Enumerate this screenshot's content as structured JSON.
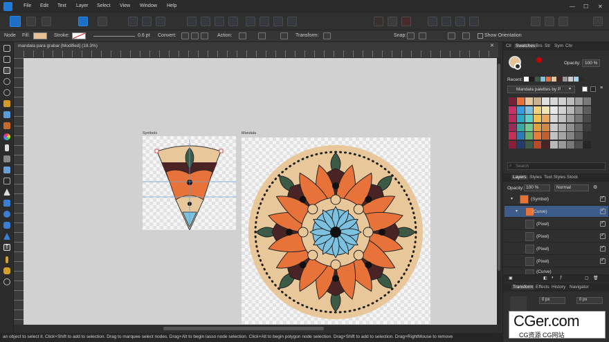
{
  "menu": {
    "items": [
      "File",
      "Edit",
      "Text",
      "Layer",
      "Select",
      "View",
      "Window",
      "Help"
    ]
  },
  "context": {
    "mode": "Node",
    "fill_label": "Fill:",
    "fill_color": "#e6c194",
    "stroke_label": "Stroke:",
    "stroke_width": "0.6 pt",
    "convert_label": "Convert:",
    "action_label": "Action:",
    "transform_label": "Transform:",
    "snap_label": "Snap:",
    "show_orientation": "Show Orientation"
  },
  "document": {
    "title": "mandala para grabar [Modified] (18.3%)"
  },
  "artboards": {
    "symbols": "Symbols",
    "mandala": "Mandala"
  },
  "panel": {
    "swatch_tabs": [
      "Clr",
      "Swatches",
      "Brs",
      "Str",
      "Sym",
      "Chr"
    ],
    "opacity_label": "Opacity:",
    "opacity_value": "100 %",
    "recent_label": "Recent:",
    "palette_name": "Mandala palettes by P",
    "search_placeholder": "Search",
    "layer_tabs": [
      "Layers",
      "Styles",
      "Text Styles",
      "Stock"
    ],
    "layer_opacity_label": "Opacity:",
    "layer_opacity_value": "100 %",
    "blend_mode": "Normal",
    "layers": [
      "(Symbol)",
      "(Curve)",
      "(Pixel)",
      "(Pixel)",
      "(Pixel)",
      "(Pixel)",
      "(Curve)"
    ],
    "transform_tabs": [
      "Transform",
      "Effects",
      "History",
      "Navigator"
    ],
    "transform_value": "0 px"
  },
  "status": {
    "text": "an object to select it. Click+Shift to add to selection. Drag to marquee select nodes. Drag+Alt to begin lasso node selection. Click+Alt to begin polygon node selection. Drag+Shift to add to selection. Drag+RightMouse to remove"
  },
  "watermark": {
    "title": "CGer.com",
    "subtitle": "CG资源 CG网站"
  },
  "colors": {
    "accent": "#1f7ad8",
    "orange": "#e8733a",
    "dark": "#4a2424",
    "green": "#3c5a46",
    "tan": "#e8c79a",
    "light_blue": "#7cc1e0"
  }
}
